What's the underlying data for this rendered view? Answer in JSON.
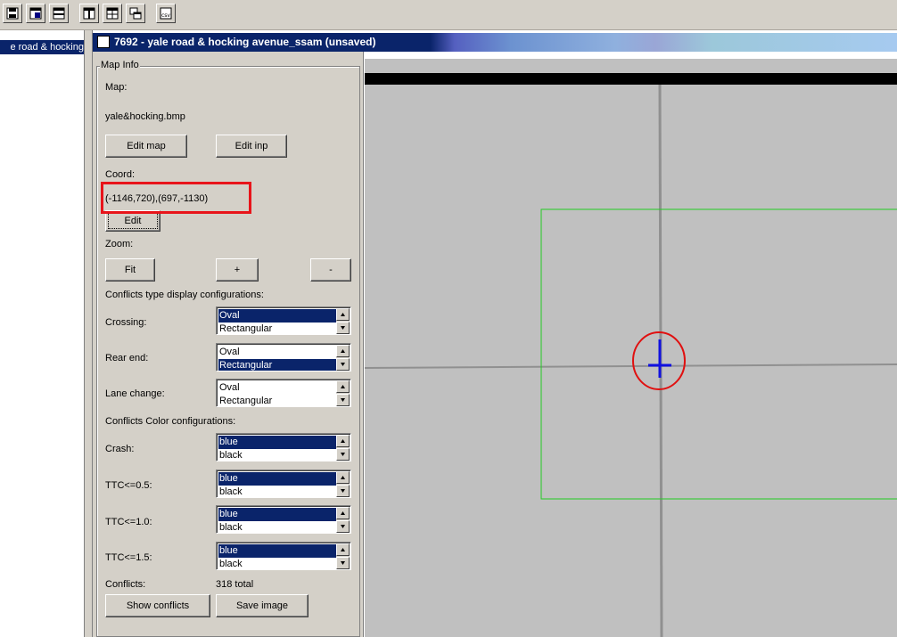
{
  "doc_tab": {
    "label": "e road & hocking"
  },
  "window": {
    "title": "7692 - yale road & hocking avenue_ssam (unsaved)"
  },
  "toolbar": {
    "icons": [
      "save-icon",
      "open-panel-icon",
      "split-horizontal-icon",
      "split-vertical-icon",
      "grid-icon",
      "cascade-icon",
      "csv-export-icon"
    ]
  },
  "panel": {
    "group_title": "Map Info",
    "map_label": "Map:",
    "map_file": "yale&hocking.bmp",
    "edit_map": "Edit map",
    "edit_inp": "Edit inp",
    "coord_label": "Coord:",
    "coord_value": "(-1146,720),(697,-1130)",
    "edit": "Edit",
    "zoom_label": "Zoom:",
    "zoom_fit": "Fit",
    "zoom_in": "+",
    "zoom_out": "-",
    "conflict_type_heading": "Conflicts type display configurations:",
    "crossing_label": "Crossing:",
    "crossing_options": [
      "Oval",
      "Rectangular"
    ],
    "crossing_selected": "Oval",
    "rear_end_label": "Rear end:",
    "rear_end_options": [
      "Oval",
      "Rectangular"
    ],
    "rear_end_selected": "Rectangular",
    "lane_change_label": "Lane change:",
    "lane_change_options": [
      "Oval",
      "Rectangular"
    ],
    "lane_change_selected": "",
    "color_heading": "Conflicts Color configurations:",
    "crash_label": "Crash:",
    "crash_options": [
      "blue",
      "black"
    ],
    "crash_selected": "blue",
    "ttc05_label": "TTC<=0.5:",
    "ttc05_options": [
      "blue",
      "black"
    ],
    "ttc05_selected": "blue",
    "ttc10_label": "TTC<=1.0:",
    "ttc10_options": [
      "blue",
      "black"
    ],
    "ttc10_selected": "blue",
    "ttc15_label": "TTC<=1.5:",
    "ttc15_options": [
      "blue",
      "black"
    ],
    "ttc15_selected": "blue",
    "conflicts_label": "Conflicts:",
    "conflicts_total": "318 total",
    "show_conflicts": "Show conflicts",
    "save_image": "Save image"
  },
  "colors": {
    "selection": "#0a246a",
    "highlight": "#e8141a",
    "viewport_rect": "#22cc22",
    "marker": "#1010e0",
    "road": "#909090"
  }
}
